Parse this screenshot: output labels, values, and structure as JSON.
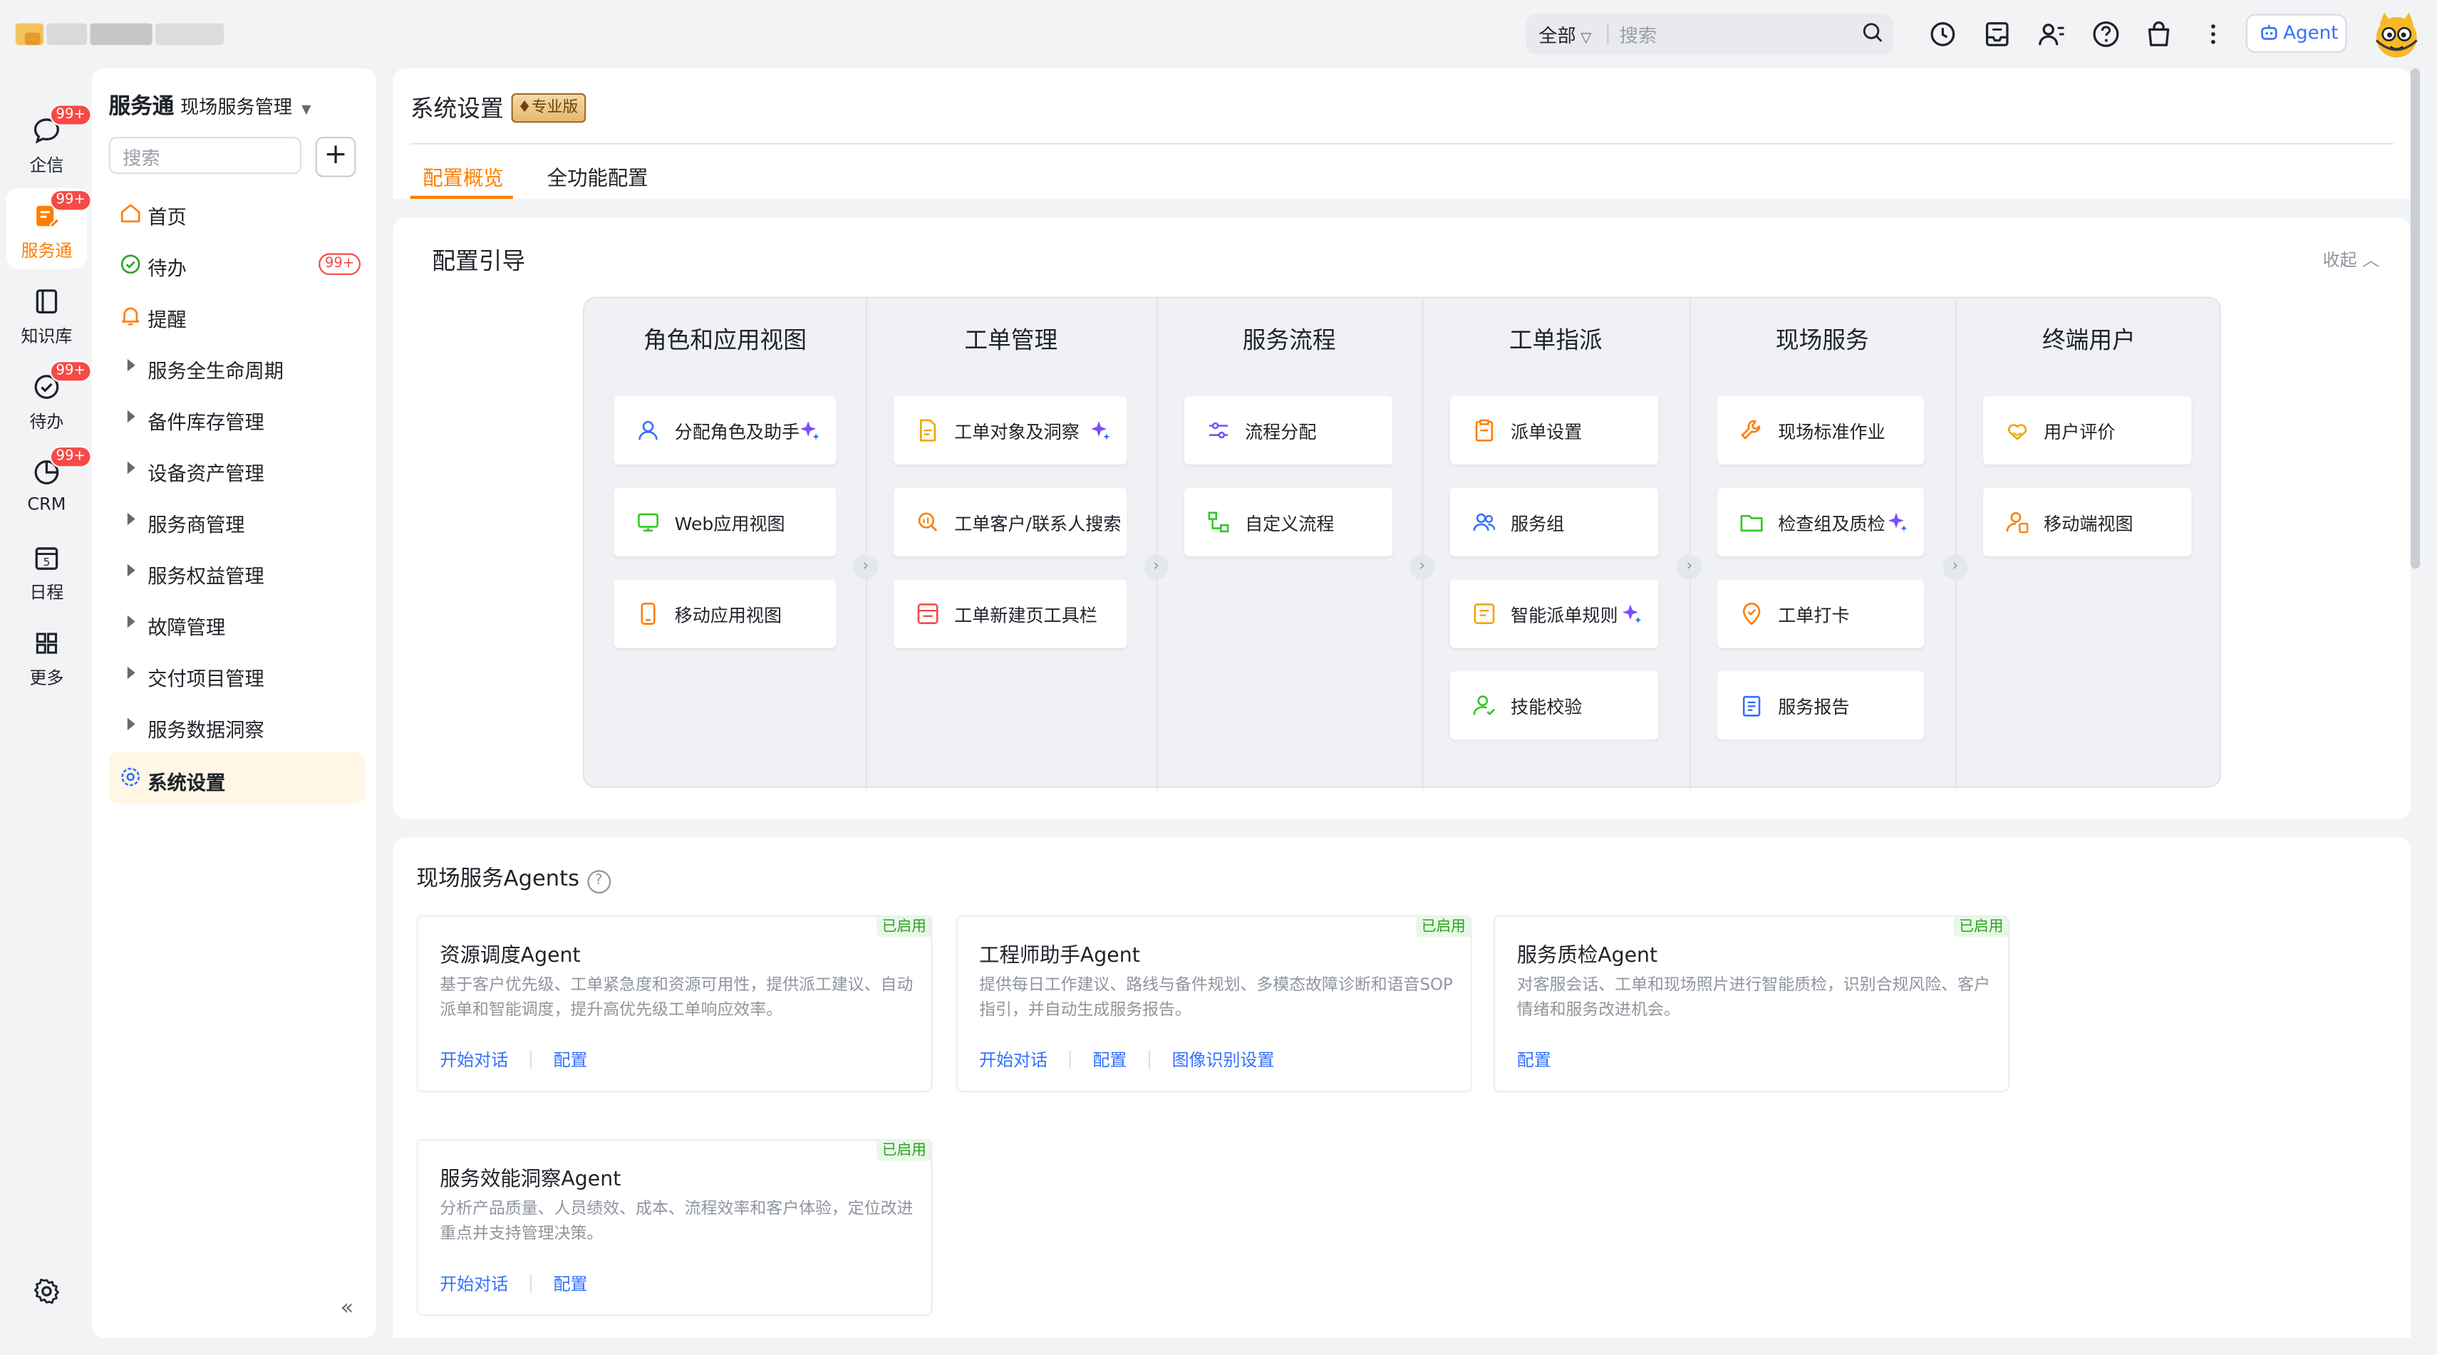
{
  "topbar": {
    "scope": "全部",
    "search_placeholder": "搜索",
    "agent_label": "Agent"
  },
  "rail": {
    "items": [
      {
        "label": "企信",
        "badge": "99+"
      },
      {
        "label": "服务通",
        "badge": "99+"
      },
      {
        "label": "知识库",
        "badge": ""
      },
      {
        "label": "待办",
        "badge": "99+"
      },
      {
        "label": "CRM",
        "badge": "99+"
      },
      {
        "label": "日程",
        "badge": ""
      },
      {
        "label": "更多",
        "badge": ""
      }
    ]
  },
  "sidebar": {
    "title": "服务通",
    "subtitle": "现场服务管理",
    "search_placeholder": "搜索",
    "add_label": "+",
    "items": [
      {
        "label": "首页"
      },
      {
        "label": "待办",
        "badge": "99+"
      },
      {
        "label": "提醒"
      },
      {
        "label": "服务全生命周期"
      },
      {
        "label": "备件库存管理"
      },
      {
        "label": "设备资产管理"
      },
      {
        "label": "服务商管理"
      },
      {
        "label": "服务权益管理"
      },
      {
        "label": "故障管理"
      },
      {
        "label": "交付项目管理"
      },
      {
        "label": "服务数据洞察"
      },
      {
        "label": "系统设置"
      }
    ]
  },
  "header": {
    "title": "系统设置",
    "edition": "专业版",
    "tabs": [
      {
        "label": "配置概览"
      },
      {
        "label": "全功能配置"
      }
    ]
  },
  "guide": {
    "title": "配置引导",
    "collapse_label": "收起",
    "columns": [
      {
        "title": "角色和应用视图",
        "items": [
          {
            "label": "分配角色及助手",
            "icon": "user-icon",
            "ai": true
          },
          {
            "label": "Web应用视图",
            "icon": "monitor-icon",
            "ai": false
          },
          {
            "label": "移动应用视图",
            "icon": "mobile-icon",
            "ai": false
          }
        ]
      },
      {
        "title": "工单管理",
        "items": [
          {
            "label": "工单对象及洞察",
            "icon": "document-icon",
            "ai": true
          },
          {
            "label": "工单客户/联系人搜索",
            "icon": "search-doc-icon",
            "ai": false
          },
          {
            "label": "工单新建页工具栏",
            "icon": "toolbar-icon",
            "ai": false
          }
        ]
      },
      {
        "title": "服务流程",
        "items": [
          {
            "label": "流程分配",
            "icon": "sliders-icon",
            "ai": false
          },
          {
            "label": "自定义流程",
            "icon": "flow-icon",
            "ai": false
          }
        ]
      },
      {
        "title": "工单指派",
        "items": [
          {
            "label": "派单设置",
            "icon": "clipboard-icon",
            "ai": false
          },
          {
            "label": "服务组",
            "icon": "group-icon",
            "ai": false
          },
          {
            "label": "智能派单规则",
            "icon": "rules-icon",
            "ai": true
          },
          {
            "label": "技能校验",
            "icon": "skill-icon",
            "ai": false
          }
        ]
      },
      {
        "title": "现场服务",
        "items": [
          {
            "label": "现场标准作业",
            "icon": "wrench-icon",
            "ai": false
          },
          {
            "label": "检查组及质检",
            "icon": "folder-icon",
            "ai": true
          },
          {
            "label": "工单打卡",
            "icon": "location-icon",
            "ai": false
          },
          {
            "label": "服务报告",
            "icon": "report-icon",
            "ai": false
          }
        ]
      },
      {
        "title": "终端用户",
        "items": [
          {
            "label": "用户评价",
            "icon": "rating-icon",
            "ai": false
          },
          {
            "label": "移动端视图",
            "icon": "mobile-user-icon",
            "ai": false
          }
        ]
      }
    ]
  },
  "agents": {
    "title": "现场服务Agents",
    "help": "?",
    "cards": [
      {
        "name": "资源调度Agent",
        "status": "已启用",
        "desc": "基于客户优先级、工单紧急度和资源可用性，提供派工建议、自动派单和智能调度，提升高优先级工单响应效率。",
        "links": [
          "开始对话",
          "配置"
        ]
      },
      {
        "name": "工程师助手Agent",
        "status": "已启用",
        "desc": "提供每日工作建议、路线与备件规划、多模态故障诊断和语音SOP 指引，并自动生成服务报告。",
        "links": [
          "开始对话",
          "配置",
          "图像识别设置"
        ]
      },
      {
        "name": "服务质检Agent",
        "status": "已启用",
        "desc": "对客服会话、工单和现场照片进行智能质检，识别合规风险、客户情绪和服务改进机会。",
        "links": [
          "配置"
        ]
      },
      {
        "name": "服务效能洞察Agent",
        "status": "已启用",
        "desc": "分析产品质量、人员绩效、成本、流程效率和客户体验，定位改进重点并支持管理决策。",
        "links": [
          "开始对话",
          "配置"
        ]
      }
    ]
  },
  "colors": {
    "accent": "#ff7d00",
    "link": "#3370ff",
    "badge": "#f54a45",
    "enabled": "#2ea121"
  }
}
